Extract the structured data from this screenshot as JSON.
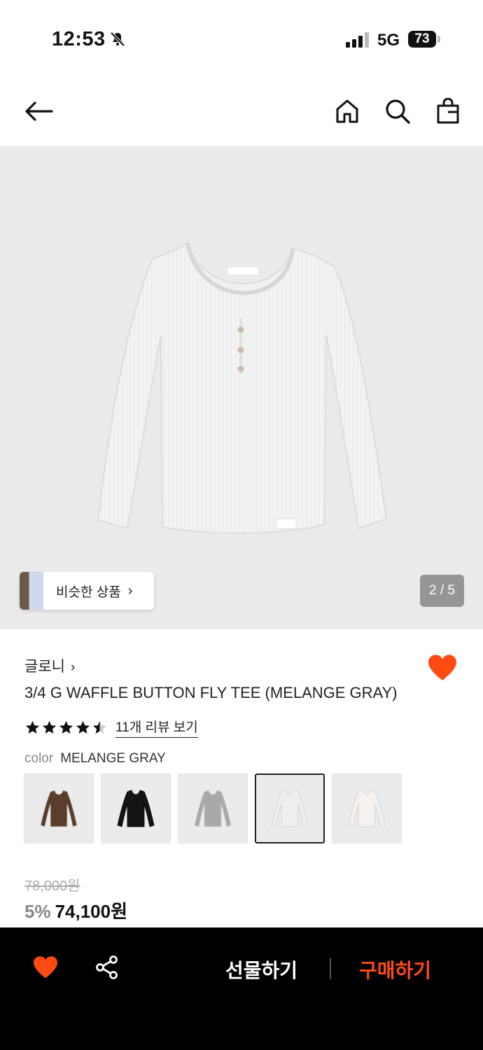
{
  "status_bar": {
    "time": "12:53",
    "network": "5G",
    "battery": "73"
  },
  "header": {
    "back_icon": "arrow-left-icon",
    "home_icon": "home-icon",
    "search_icon": "search-icon",
    "bag_icon": "shopping-bag-icon"
  },
  "hero": {
    "similar_label": "비슷한 상품",
    "counter": "2 / 5"
  },
  "product": {
    "brand": "글로니",
    "title": "3/4 G WAFFLE BUTTON FLY TEE (MELANGE GRAY)",
    "rating": 4.5,
    "review_link": "11개 리뷰 보기",
    "color_key": "color",
    "color_value": "MELANGE GRAY",
    "swatches": [
      {
        "color": "#5a3e2b"
      },
      {
        "color": "#141414"
      },
      {
        "color": "#a9a9a9"
      },
      {
        "color": "#efefef"
      },
      {
        "color": "#f5f1ee"
      }
    ],
    "selected_swatch": 3,
    "original_price": "78,000원",
    "discount": "5%",
    "price": "74,100원"
  },
  "bottom_bar": {
    "gift_label": "선물하기",
    "buy_label": "구매하기"
  },
  "colors": {
    "accent": "#ff4a13"
  }
}
